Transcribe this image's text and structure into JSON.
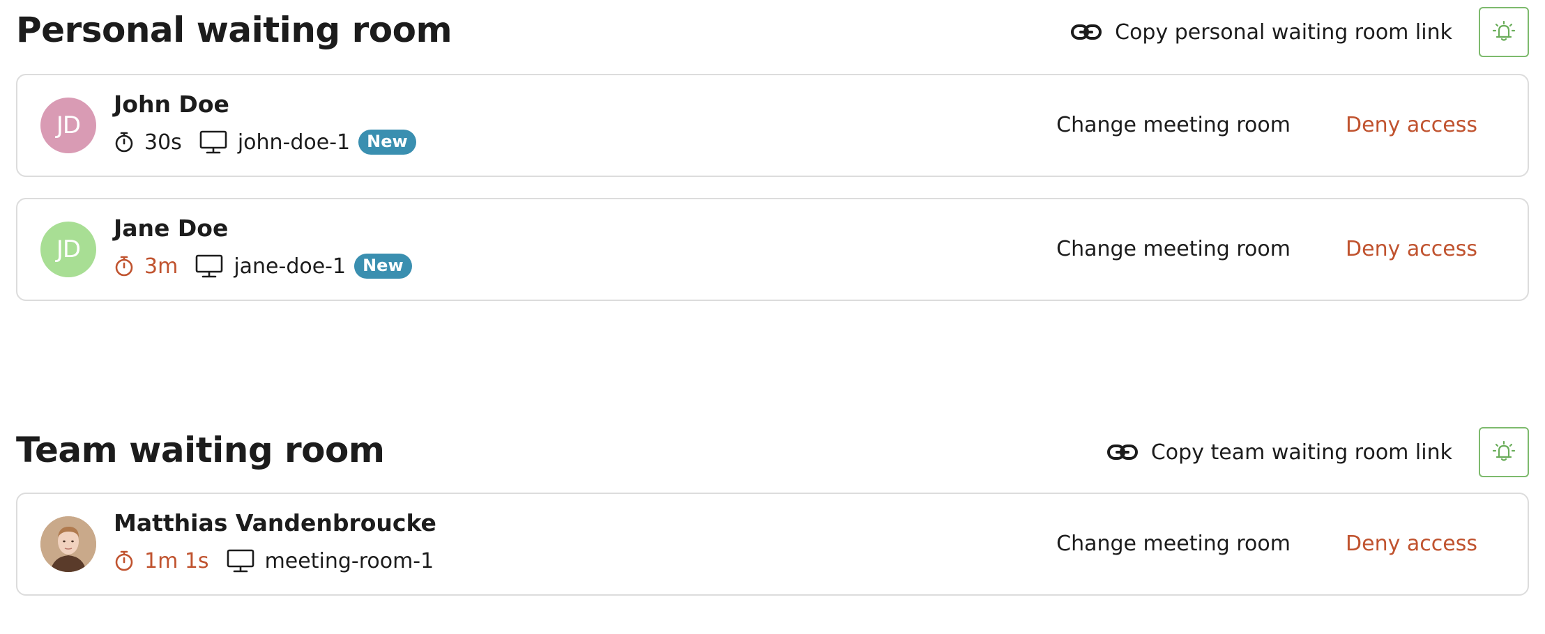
{
  "personal": {
    "title": "Personal waiting room",
    "copy_link_label": "Copy personal waiting room link",
    "guests": [
      {
        "name": "John Doe",
        "initials": "JD",
        "avatar_color": "#d99bb4",
        "wait_time": "30s",
        "wait_overdue": false,
        "room": "john-doe-1",
        "badge": "New",
        "change_room_label": "Change meeting room",
        "deny_label": "Deny access"
      },
      {
        "name": "Jane Doe",
        "initials": "JD",
        "avatar_color": "#a8de94",
        "wait_time": "3m",
        "wait_overdue": true,
        "room": "jane-doe-1",
        "badge": "New",
        "change_room_label": "Change meeting room",
        "deny_label": "Deny access"
      }
    ]
  },
  "team": {
    "title": "Team waiting room",
    "copy_link_label": "Copy team waiting room link",
    "guests": [
      {
        "name": "Matthias Vandenbroucke",
        "avatar": "profile-photo",
        "wait_time": "1m 1s",
        "wait_overdue": true,
        "room": "meeting-room-1",
        "change_room_label": "Change meeting room",
        "deny_label": "Deny access"
      }
    ]
  },
  "colors": {
    "overdue": "#c0532f",
    "normal": "#1c1c1c",
    "badge": "#3a8fb0",
    "bell_border": "#7dba6d",
    "deny": "#c0532f"
  },
  "icons": {
    "link": "link-icon",
    "bell": "bell-ringing-icon",
    "timer": "stopwatch-icon",
    "room": "monitor-icon"
  }
}
